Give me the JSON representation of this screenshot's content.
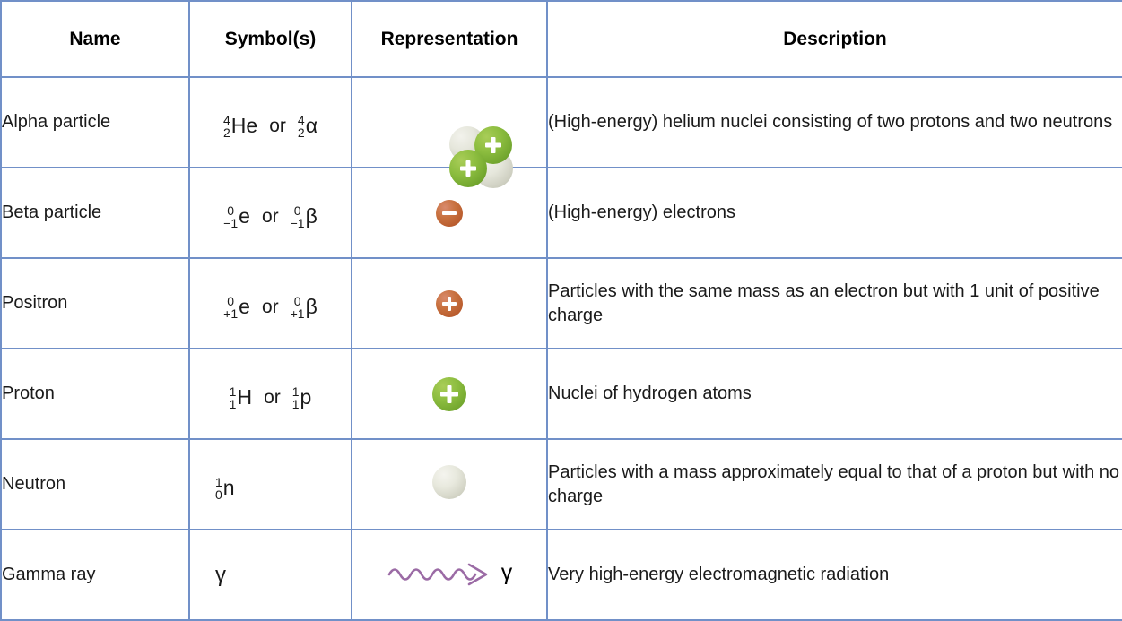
{
  "table": {
    "headers": [
      "Name",
      "Symbol(s)",
      "Representation",
      "Description"
    ],
    "colors": {
      "border": "#7190c8",
      "header_bg": "#dde3f3",
      "proton_green": "#8cbd3f",
      "neutron_grey": "#e6e7dc",
      "charge_red": "#c8713f",
      "gamma_purple": "#9b6ba5"
    },
    "rows": [
      {
        "name": "Alpha particle",
        "symbol": {
          "type": "isotope-pair",
          "first": {
            "mass": "4",
            "charge": "2",
            "element": "He"
          },
          "conjunction": "or",
          "second": {
            "mass": "4",
            "charge": "2",
            "element": "α"
          }
        },
        "representation": {
          "icon": "alpha-particle-cluster-icon",
          "spheres": [
            "neutron",
            "proton",
            "proton",
            "neutron"
          ]
        },
        "description": "(High-energy) helium nuclei consisting of two protons and two neutrons"
      },
      {
        "name": "Beta particle",
        "symbol": {
          "type": "isotope-pair",
          "first": {
            "mass": "0",
            "charge": "−1",
            "element": "e"
          },
          "conjunction": "or",
          "second": {
            "mass": "0",
            "charge": "−1",
            "element": "β"
          }
        },
        "representation": {
          "icon": "negative-charge-circle-icon",
          "glyph": "−"
        },
        "description": "(High-energy) electrons"
      },
      {
        "name": "Positron",
        "symbol": {
          "type": "isotope-pair",
          "first": {
            "mass": "0",
            "charge": "+1",
            "element": "e"
          },
          "conjunction": "or",
          "second": {
            "mass": "0",
            "charge": "+1",
            "element": "β"
          }
        },
        "representation": {
          "icon": "positive-charge-circle-icon",
          "glyph": "+"
        },
        "description": "Particles with the same mass as an electron but with 1 unit of positive charge"
      },
      {
        "name": "Proton",
        "symbol": {
          "type": "isotope-pair",
          "first": {
            "mass": "1",
            "charge": "1",
            "element": "H"
          },
          "conjunction": "or",
          "second": {
            "mass": "1",
            "charge": "1",
            "element": "p"
          }
        },
        "representation": {
          "icon": "proton-sphere-icon",
          "glyph": "+"
        },
        "description": "Nuclei of hydrogen atoms"
      },
      {
        "name": "Neutron",
        "symbol": {
          "type": "isotope-single",
          "first": {
            "mass": "1",
            "charge": "0",
            "element": "n"
          }
        },
        "representation": {
          "icon": "neutron-sphere-icon",
          "glyph": ""
        },
        "description": "Particles with a mass approximately equal to that of a proton but with no charge"
      },
      {
        "name": "Gamma ray",
        "symbol": {
          "type": "plain",
          "text": "γ"
        },
        "representation": {
          "icon": "gamma-wave-arrow-icon",
          "letter": "γ"
        },
        "description": "Very high-energy electromagnetic radiation"
      }
    ]
  }
}
